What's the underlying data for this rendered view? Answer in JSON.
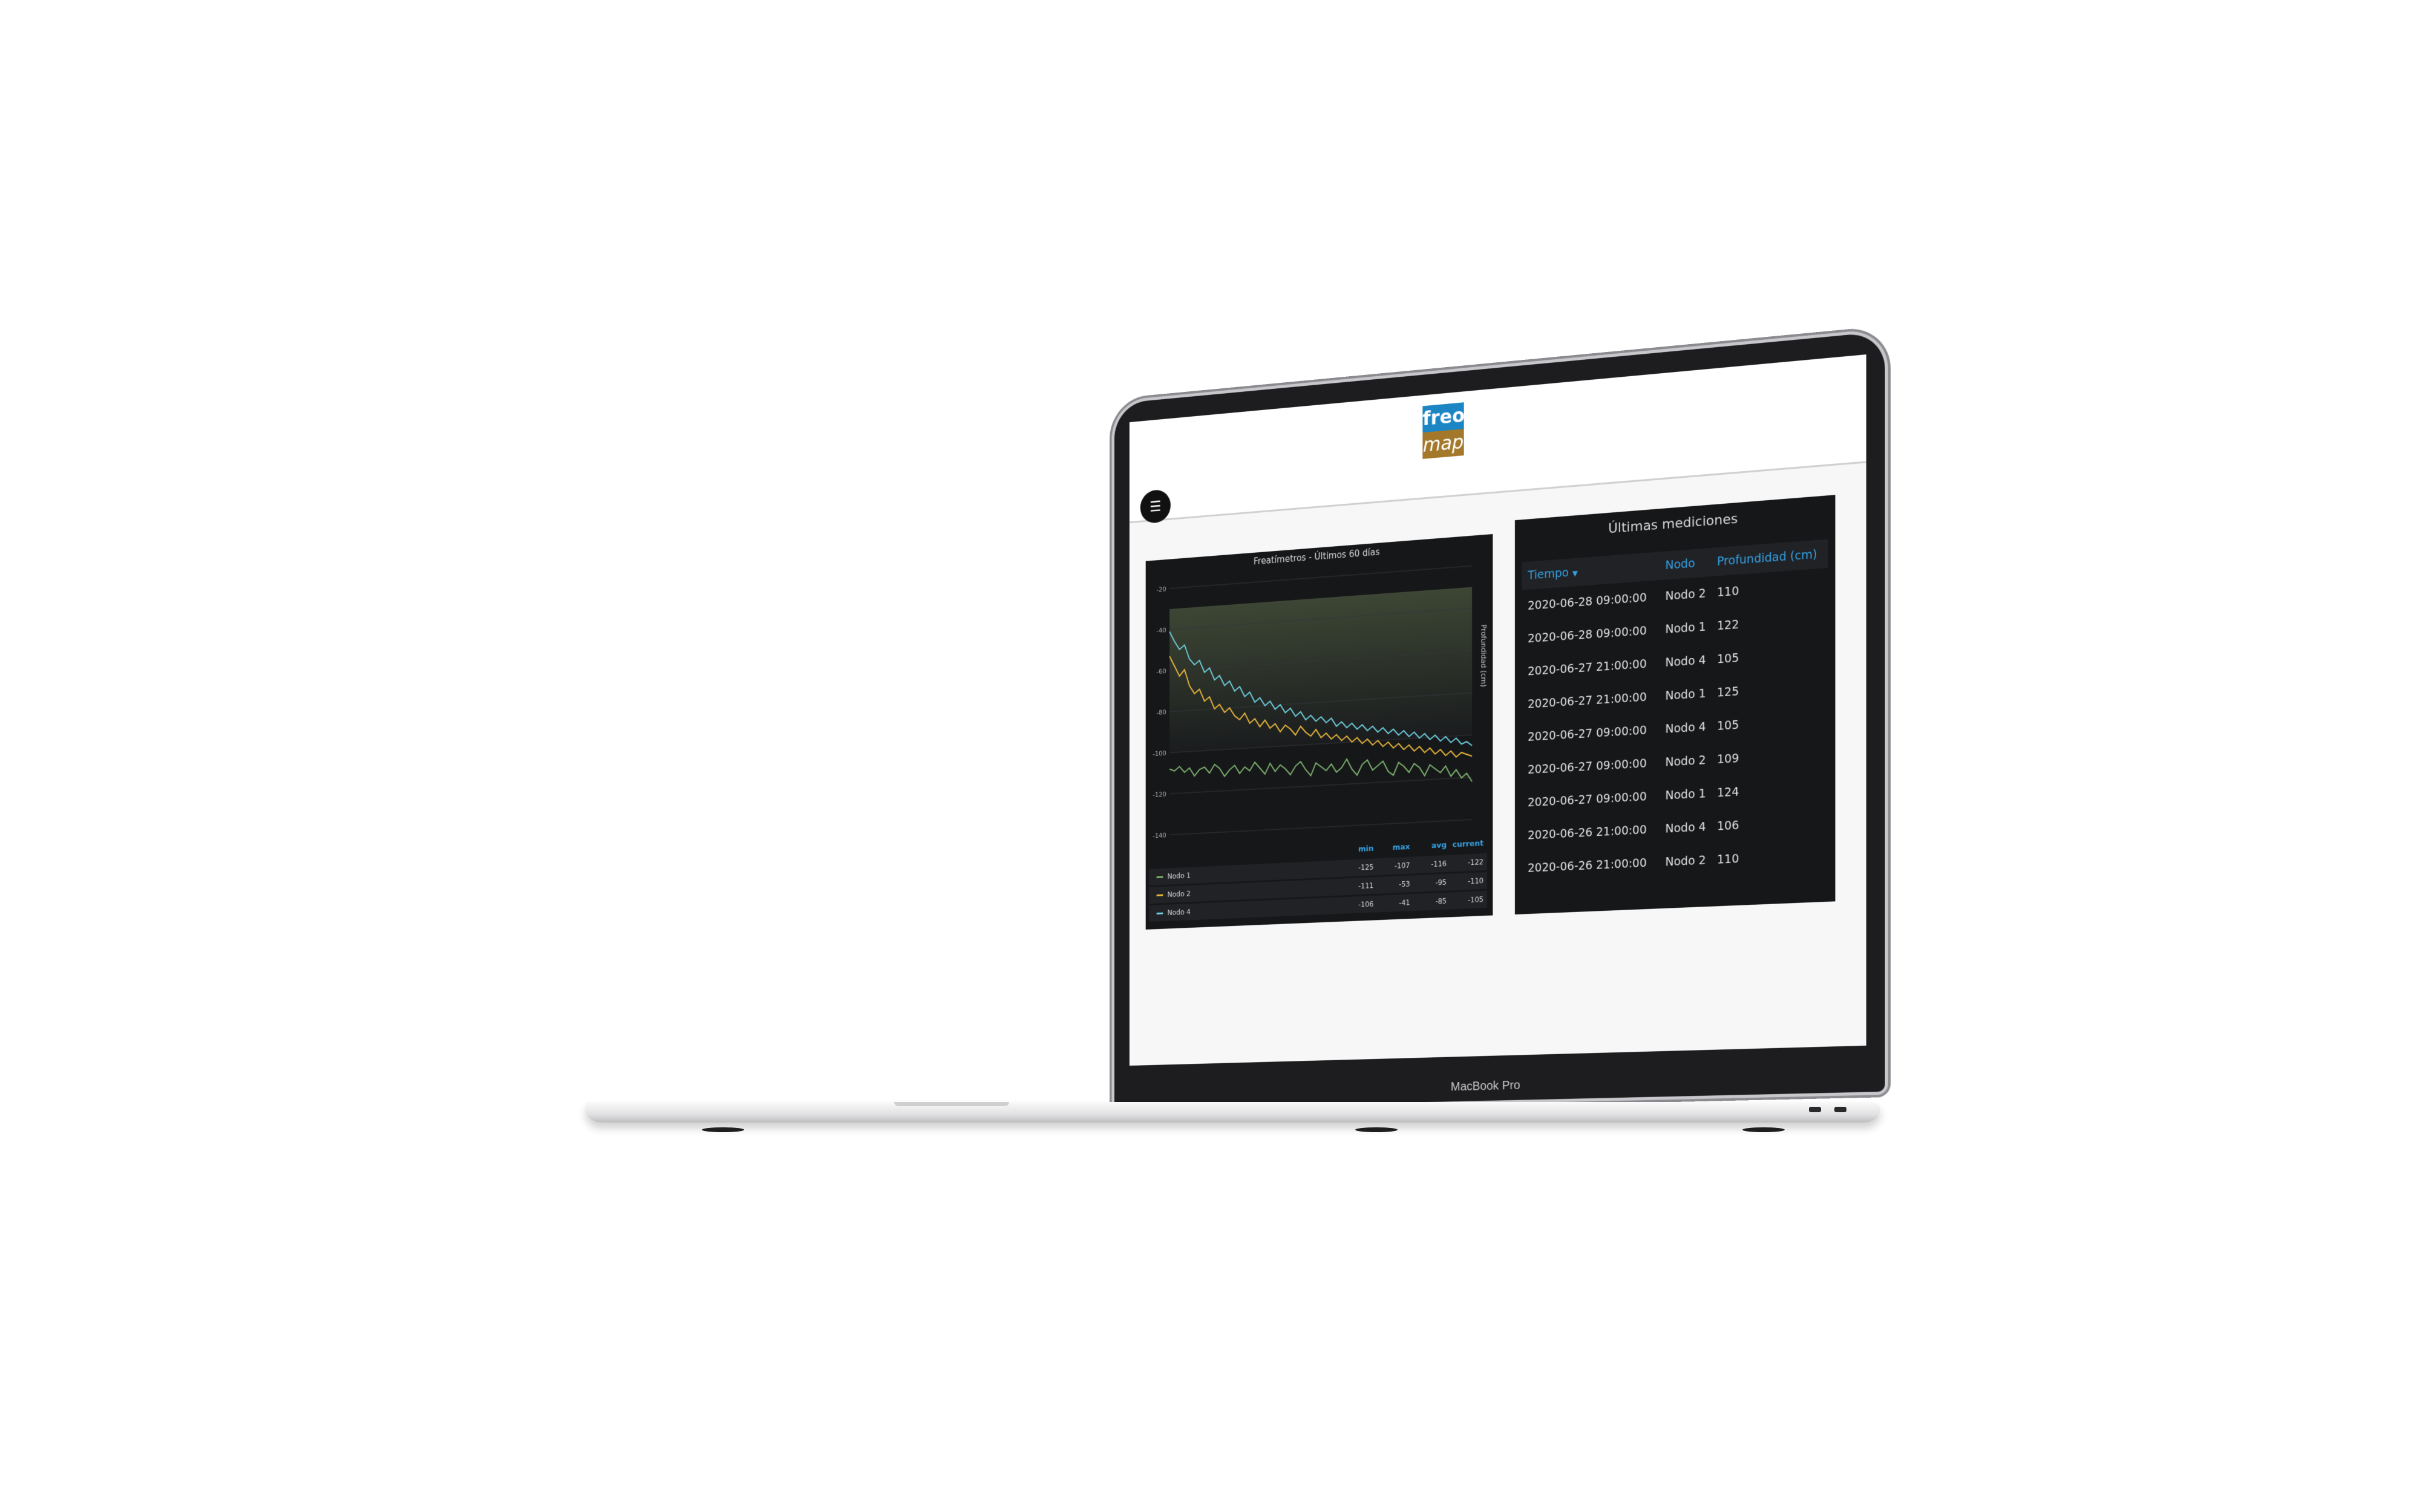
{
  "app": {
    "logo": {
      "top": "freo",
      "bottom": "map"
    },
    "menu_icon": "hamburger-menu-icon",
    "colors": {
      "logo_blue": "#1c86c5",
      "logo_brown": "#a3782a",
      "panel_bg": "#161719",
      "header_blue": "#33a2e5"
    }
  },
  "device": {
    "label": "MacBook Pro"
  },
  "chart_panel": {
    "title": "Freatímetros - Últimos 60 días"
  },
  "chart_data": {
    "type": "line",
    "title": "Freatímetros - Últimos 60 días",
    "xlabel": "",
    "ylabel": "Profundidad (cm)",
    "ylim": [
      -140,
      -20
    ],
    "yticks": [
      -20,
      -40,
      -60,
      -80,
      -100,
      -120,
      -140
    ],
    "grid": true,
    "legend_position": "bottom",
    "x": [
      0,
      1,
      2,
      3,
      4,
      5,
      6,
      7,
      8,
      9,
      10,
      11,
      12,
      13,
      14,
      15,
      16,
      17,
      18,
      19,
      20,
      21,
      22,
      23,
      24,
      25,
      26,
      27,
      28,
      29,
      30,
      31,
      32,
      33,
      34,
      35,
      36,
      37,
      38,
      39,
      40,
      41,
      42,
      43,
      44,
      45,
      46,
      47,
      48,
      49,
      50,
      51,
      52,
      53,
      54,
      55,
      56,
      57,
      58,
      59
    ],
    "series": [
      {
        "name": "Nodo 1",
        "color": "#7eb26d",
        "values": [
          -108,
          -109,
          -107,
          -110,
          -108,
          -112,
          -109,
          -108,
          -111,
          -107,
          -109,
          -113,
          -110,
          -108,
          -112,
          -109,
          -111,
          -107,
          -110,
          -113,
          -108,
          -112,
          -109,
          -111,
          -114,
          -110,
          -108,
          -112,
          -115,
          -109,
          -111,
          -113,
          -110,
          -114,
          -112,
          -108,
          -113,
          -116,
          -111,
          -109,
          -114,
          -112,
          -110,
          -115,
          -117,
          -111,
          -113,
          -116,
          -112,
          -114,
          -118,
          -113,
          -115,
          -117,
          -114,
          -119,
          -116,
          -120,
          -118,
          -122
        ],
        "stats": {
          "min": "-125",
          "max": "-107",
          "avg": "-116",
          "current": "-122"
        }
      },
      {
        "name": "Nodo 2",
        "color": "#eab839",
        "values": [
          -53,
          -58,
          -63,
          -60,
          -68,
          -72,
          -70,
          -76,
          -74,
          -80,
          -78,
          -82,
          -80,
          -84,
          -86,
          -83,
          -88,
          -86,
          -90,
          -87,
          -91,
          -89,
          -93,
          -90,
          -92,
          -95,
          -91,
          -94,
          -96,
          -93,
          -97,
          -95,
          -98,
          -96,
          -99,
          -97,
          -100,
          -98,
          -101,
          -99,
          -102,
          -100,
          -103,
          -101,
          -104,
          -102,
          -105,
          -103,
          -106,
          -104,
          -107,
          -105,
          -108,
          -106,
          -109,
          -107,
          -110,
          -108,
          -109,
          -110
        ],
        "stats": {
          "min": "-111",
          "max": "-53",
          "avg": "-95",
          "current": "-110"
        }
      },
      {
        "name": "Nodo 4",
        "color": "#6ed0e0",
        "values": [
          -41,
          -46,
          -50,
          -48,
          -55,
          -58,
          -56,
          -62,
          -60,
          -66,
          -64,
          -69,
          -67,
          -72,
          -70,
          -75,
          -73,
          -78,
          -76,
          -80,
          -78,
          -82,
          -80,
          -84,
          -82,
          -86,
          -84,
          -88,
          -86,
          -89,
          -87,
          -90,
          -88,
          -92,
          -90,
          -93,
          -91,
          -94,
          -92,
          -95,
          -93,
          -96,
          -94,
          -97,
          -95,
          -98,
          -96,
          -99,
          -97,
          -100,
          -98,
          -101,
          -99,
          -102,
          -100,
          -103,
          -101,
          -104,
          -103,
          -105
        ],
        "stats": {
          "min": "-106",
          "max": "-41",
          "avg": "-85",
          "current": "-105"
        }
      }
    ],
    "legend_columns": [
      "min",
      "max",
      "avg",
      "current"
    ]
  },
  "table_panel": {
    "title": "Últimas mediciones",
    "columns": [
      "Tiempo",
      "Nodo",
      "Profundidad (cm)"
    ],
    "sort_icon": "caret-down-icon",
    "rows": [
      [
        "2020-06-28 09:00:00",
        "Nodo 2",
        "110"
      ],
      [
        "2020-06-28 09:00:00",
        "Nodo 1",
        "122"
      ],
      [
        "2020-06-27 21:00:00",
        "Nodo 4",
        "105"
      ],
      [
        "2020-06-27 21:00:00",
        "Nodo 1",
        "125"
      ],
      [
        "2020-06-27 09:00:00",
        "Nodo 4",
        "105"
      ],
      [
        "2020-06-27 09:00:00",
        "Nodo 2",
        "109"
      ],
      [
        "2020-06-27 09:00:00",
        "Nodo 1",
        "124"
      ],
      [
        "2020-06-26 21:00:00",
        "Nodo 4",
        "106"
      ],
      [
        "2020-06-26 21:00:00",
        "Nodo 2",
        "110"
      ]
    ]
  }
}
